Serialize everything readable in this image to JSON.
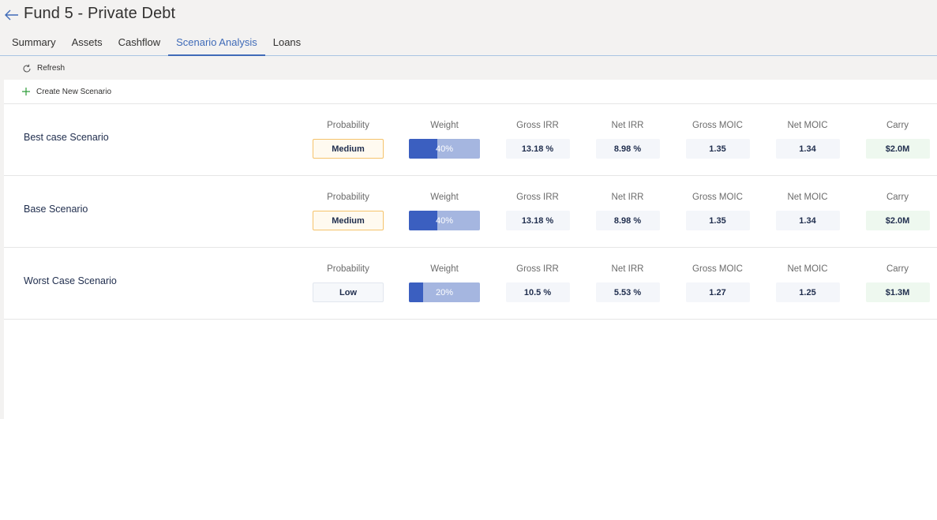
{
  "header": {
    "title": "Fund 5 - Private Debt",
    "back_icon": "arrow-left-icon"
  },
  "tabs": [
    {
      "label": "Summary",
      "active": false
    },
    {
      "label": "Assets",
      "active": false
    },
    {
      "label": "Cashflow",
      "active": false
    },
    {
      "label": "Scenario Analysis",
      "active": true
    },
    {
      "label": "Loans",
      "active": false
    }
  ],
  "toolbar": {
    "refresh_label": "Refresh",
    "refresh_icon": "refresh-icon"
  },
  "create": {
    "label": "Create New Scenario",
    "icon": "plus-icon"
  },
  "columns": {
    "probability": "Probability",
    "weight": "Weight",
    "gross_irr": "Gross IRR",
    "net_irr": "Net IRR",
    "gross_moic": "Gross MOIC",
    "net_moic": "Net MOIC",
    "carry": "Carry"
  },
  "scenarios": [
    {
      "name": "Best case Scenario",
      "probability": "Medium",
      "weight": "40%",
      "weight_fraction": 0.4,
      "gross_irr": "13.18 %",
      "net_irr": "8.98 %",
      "gross_moic": "1.35",
      "net_moic": "1.34",
      "carry": "$2.0M"
    },
    {
      "name": "Base Scenario",
      "probability": "Medium",
      "weight": "40%",
      "weight_fraction": 0.4,
      "gross_irr": "13.18 %",
      "net_irr": "8.98 %",
      "gross_moic": "1.35",
      "net_moic": "1.34",
      "carry": "$2.0M"
    },
    {
      "name": "Worst Case Scenario",
      "probability": "Low",
      "weight": "20%",
      "weight_fraction": 0.2,
      "gross_irr": "10.5 %",
      "net_irr": "5.53 %",
      "gross_moic": "1.27",
      "net_moic": "1.25",
      "carry": "$1.3M"
    }
  ],
  "colors": {
    "accent": "#3f6bb8",
    "weight_fill": "#3b5fc0",
    "weight_track": "#a5b6e0",
    "medium_border": "#f5c36b",
    "plus_green": "#2e9d3a",
    "carry_bg": "#eef8ef"
  }
}
